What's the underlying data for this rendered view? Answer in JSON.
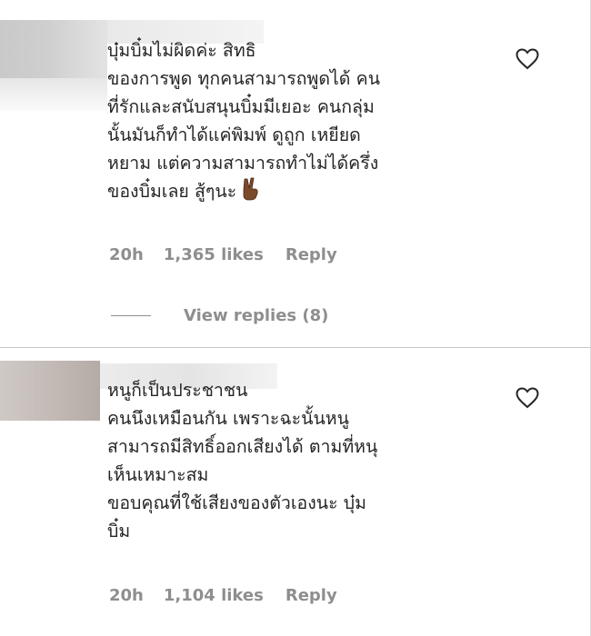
{
  "comments": [
    {
      "text": "บุ๋มบิ๋มไม่ผิดค่ะ สิทธิ\nของการพูด ทุกคนสามารถพูดได้ คน\nที่รักและสนับสนุนบิ๋มมีเยอะ คนกลุ่ม\nนั้นมันก็ทำได้แค่พิมพ์ ดูถูก เหยียด\nหยาม แต่ความสามารถทำไม่ได้ครึ่ง\nของบิ๋มเลย สู้ๆนะ",
      "emoji": "victory-hand-emoji",
      "time": "20h",
      "likes": "1,365 likes",
      "reply": "Reply",
      "view_replies": "View replies (8)"
    },
    {
      "text": "หนูก็เป็นประชาชน\nคนนึงเหมือนกัน เพราะฉะนั้นหนู\nสามารถมีสิทธิ์ออกเสียงได้ ตามที่หนุ\nเห็นเหมาะสม\nขอบคุณที่ใช้เสียงของตัวเองนะ บุ๋ม\nบิ๋ม",
      "time": "20h",
      "likes": "1,104 likes",
      "reply": "Reply"
    }
  ],
  "icons": {
    "like": "heart-icon",
    "emoji": "victory-hand-emoji"
  },
  "colors": {
    "text": "#262626",
    "muted": "#8e8e8e",
    "divider": "#c7c7c7"
  }
}
